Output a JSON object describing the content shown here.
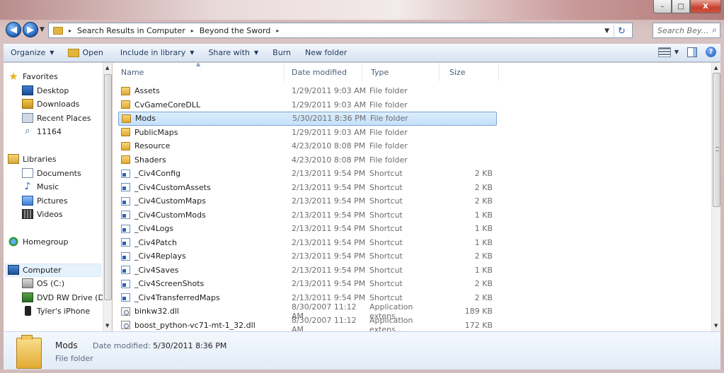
{
  "window": {
    "minimize": "–",
    "maximize": "□",
    "close": "X"
  },
  "nav": {
    "back": "◀",
    "forward": "▶",
    "history_dropdown": "▼"
  },
  "address": {
    "crumbs": [
      "Search Results in Computer",
      "Beyond the Sword"
    ],
    "separator": "▸",
    "dropdown": "▼",
    "refresh": "↻"
  },
  "search": {
    "placeholder": "Search Bey..."
  },
  "toolbar": {
    "organize": "Organize",
    "open": "Open",
    "include_in_library": "Include in library",
    "share_with": "Share with",
    "burn": "Burn",
    "new_folder": "New folder",
    "dropdown": "▼",
    "help": "?"
  },
  "sidebar": {
    "favorites": {
      "label": "Favorites",
      "items": [
        "Desktop",
        "Downloads",
        "Recent Places",
        "11164"
      ]
    },
    "libraries": {
      "label": "Libraries",
      "items": [
        "Documents",
        "Music",
        "Pictures",
        "Videos"
      ]
    },
    "homegroup": {
      "label": "Homegroup"
    },
    "computer": {
      "label": "Computer",
      "items": [
        "OS (C:)",
        "DVD RW Drive (D",
        "Tyler's iPhone"
      ]
    }
  },
  "columns": {
    "name": "Name",
    "date": "Date modified",
    "type": "Type",
    "size": "Size"
  },
  "files": [
    {
      "name": "Assets",
      "date": "1/29/2011 9:03 AM",
      "type": "File folder",
      "size": "",
      "kind": "folder"
    },
    {
      "name": "CvGameCoreDLL",
      "date": "1/29/2011 9:03 AM",
      "type": "File folder",
      "size": "",
      "kind": "folder"
    },
    {
      "name": "Mods",
      "date": "5/30/2011 8:36 PM",
      "type": "File folder",
      "size": "",
      "kind": "folder",
      "selected": true
    },
    {
      "name": "PublicMaps",
      "date": "1/29/2011 9:03 AM",
      "type": "File folder",
      "size": "",
      "kind": "folder"
    },
    {
      "name": "Resource",
      "date": "4/23/2010 8:08 PM",
      "type": "File folder",
      "size": "",
      "kind": "folder"
    },
    {
      "name": "Shaders",
      "date": "4/23/2010 8:08 PM",
      "type": "File folder",
      "size": "",
      "kind": "folder"
    },
    {
      "name": "_Civ4Config",
      "date": "2/13/2011 9:54 PM",
      "type": "Shortcut",
      "size": "2 KB",
      "kind": "shortcut"
    },
    {
      "name": "_Civ4CustomAssets",
      "date": "2/13/2011 9:54 PM",
      "type": "Shortcut",
      "size": "2 KB",
      "kind": "shortcut"
    },
    {
      "name": "_Civ4CustomMaps",
      "date": "2/13/2011 9:54 PM",
      "type": "Shortcut",
      "size": "2 KB",
      "kind": "shortcut"
    },
    {
      "name": "_Civ4CustomMods",
      "date": "2/13/2011 9:54 PM",
      "type": "Shortcut",
      "size": "1 KB",
      "kind": "shortcut"
    },
    {
      "name": "_Civ4Logs",
      "date": "2/13/2011 9:54 PM",
      "type": "Shortcut",
      "size": "1 KB",
      "kind": "shortcut"
    },
    {
      "name": "_Civ4Patch",
      "date": "2/13/2011 9:54 PM",
      "type": "Shortcut",
      "size": "1 KB",
      "kind": "shortcut"
    },
    {
      "name": "_Civ4Replays",
      "date": "2/13/2011 9:54 PM",
      "type": "Shortcut",
      "size": "2 KB",
      "kind": "shortcut"
    },
    {
      "name": "_Civ4Saves",
      "date": "2/13/2011 9:54 PM",
      "type": "Shortcut",
      "size": "1 KB",
      "kind": "shortcut"
    },
    {
      "name": "_Civ4ScreenShots",
      "date": "2/13/2011 9:54 PM",
      "type": "Shortcut",
      "size": "2 KB",
      "kind": "shortcut"
    },
    {
      "name": "_Civ4TransferredMaps",
      "date": "2/13/2011 9:54 PM",
      "type": "Shortcut",
      "size": "2 KB",
      "kind": "shortcut"
    },
    {
      "name": "binkw32.dll",
      "date": "8/30/2007 11:12 AM",
      "type": "Application extens...",
      "size": "189 KB",
      "kind": "dll"
    },
    {
      "name": "boost_python-vc71-mt-1_32.dll",
      "date": "8/30/2007 11:12 AM",
      "type": "Application extens...",
      "size": "172 KB",
      "kind": "dll"
    }
  ],
  "details": {
    "name": "Mods",
    "date_label": "Date modified:",
    "date_value": "5/30/2011 8:36 PM",
    "type": "File folder"
  }
}
